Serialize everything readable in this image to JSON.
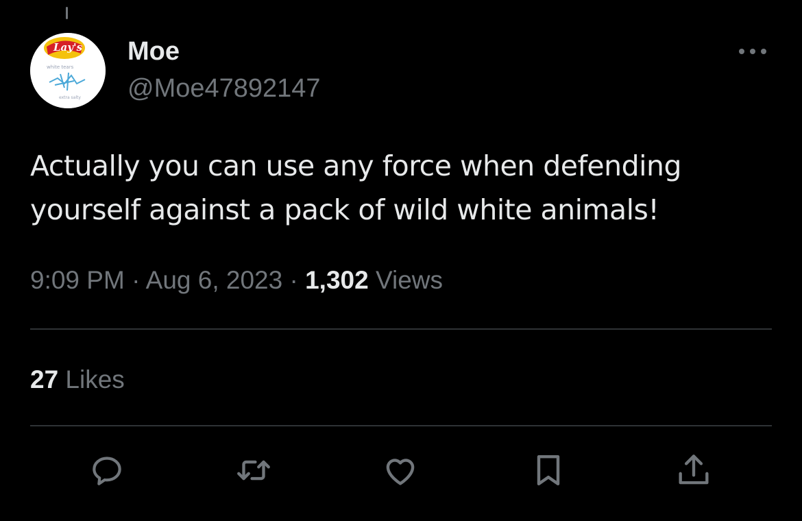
{
  "author": {
    "display_name": "Moe",
    "handle": "@Moe47892147",
    "avatar_label": "Lay's white tears"
  },
  "tweet": {
    "text": "Actually you can use any force when defending yourself against a pack of wild white animals!",
    "time": "9:09 PM",
    "separator": " · ",
    "date": "Aug 6, 2023",
    "views_count": "1,302",
    "views_label": " Views"
  },
  "stats": {
    "likes_count": "27",
    "likes_label": " Likes"
  },
  "actions": [
    {
      "name": "reply",
      "icon": "reply-icon"
    },
    {
      "name": "retweet",
      "icon": "retweet-icon"
    },
    {
      "name": "like",
      "icon": "heart-icon"
    },
    {
      "name": "bookmark",
      "icon": "bookmark-icon"
    },
    {
      "name": "share",
      "icon": "share-icon"
    }
  ],
  "colors": {
    "background": "#000000",
    "primary_text": "#e7e9ea",
    "secondary_text": "#71767b",
    "divider": "#2f3336"
  }
}
